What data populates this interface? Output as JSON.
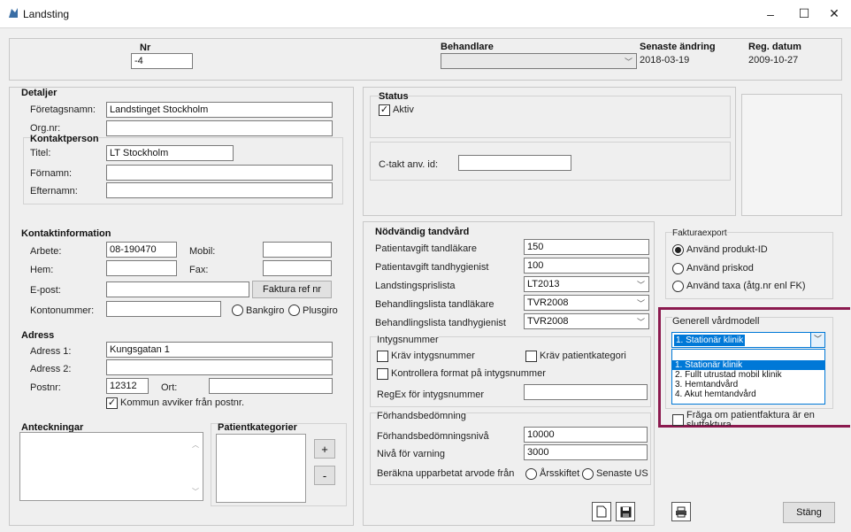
{
  "window": {
    "title": "Landsting",
    "minimize": "–",
    "maximize": "☐",
    "close": "✕"
  },
  "top": {
    "nr_label": "Nr",
    "nr_value": "-4",
    "behandlare_label": "Behandlare",
    "behandlare_value": "",
    "senaste_label": "Senaste ändring",
    "senaste_value": "2018-03-19",
    "reg_label": "Reg. datum",
    "reg_value": "2009-10-27"
  },
  "detaljer": {
    "header": "Detaljer",
    "foretag_label": "Företagsnamn:",
    "foretag_value": "Landstinget Stockholm",
    "orgnr_label": "Org.nr:",
    "orgnr_value": "",
    "kontakt_header": "Kontaktperson",
    "titel_label": "Titel:",
    "titel_value": "LT Stockholm",
    "fornamn_label": "Förnamn:",
    "fornamn_value": "",
    "efternamn_label": "Efternamn:",
    "efternamn_value": ""
  },
  "kontaktinfo": {
    "header": "Kontaktinformation",
    "arbete_label": "Arbete:",
    "arbete_value": "08-190470",
    "mobil_label": "Mobil:",
    "mobil_value": "",
    "hem_label": "Hem:",
    "hem_value": "",
    "fax_label": "Fax:",
    "fax_value": "",
    "epost_label": "E-post:",
    "epost_value": "",
    "faktura_btn": "Faktura ref nr",
    "konto_label": "Kontonummer:",
    "konto_value": "",
    "bankgiro": "Bankgiro",
    "plusgiro": "Plusgiro"
  },
  "adress": {
    "header": "Adress",
    "a1_label": "Adress 1:",
    "a1_value": "Kungsgatan 1",
    "a2_label": "Adress 2:",
    "a2_value": "",
    "postnr_label": "Postnr:",
    "postnr_value": "12312",
    "ort_label": "Ort:",
    "ort_value": "",
    "kommun_label": "Kommun avviker från postnr."
  },
  "anteckningar": {
    "header": "Anteckningar"
  },
  "patientkat": {
    "header": "Patientkategorier",
    "plus": "+",
    "minus": "-"
  },
  "status": {
    "header": "Status",
    "aktiv": "Aktiv",
    "ctakt_label": "C-takt anv. id:",
    "ctakt_value": ""
  },
  "nodvandig": {
    "header": "Nödvändig tandvård",
    "pat_tandlakare_label": "Patientavgift tandläkare",
    "pat_tandlakare_value": "150",
    "pat_hygienist_label": "Patientavgift tandhygienist",
    "pat_hygienist_value": "100",
    "prislista_label": "Landstingsprislista",
    "prislista_value": "LT2013",
    "bl_tandlakare_label": "Behandlingslista tandläkare",
    "bl_tandlakare_value": "TVR2008",
    "bl_hygienist_label": "Behandlingslista tandhygienist",
    "bl_hygienist_value": "TVR2008",
    "intyg_header": "Intygsnummer",
    "krav_intyg": "Kräv intygsnummer",
    "krav_patkat": "Kräv patientkategori",
    "kontrollera": "Kontrollera format på intygsnummer",
    "regex_label": "RegEx för intygsnummer",
    "regex_value": "",
    "forhands_header": "Förhandsbedömning",
    "forhands_niva_label": "Förhandsbedömningsnivå",
    "forhands_niva_value": "10000",
    "varning_label": "Nivå för varning",
    "varning_value": "3000",
    "berakna_label": "Beräkna upparbetat arvode från",
    "arsskiftet": "Årsskiftet",
    "senaste_us": "Senaste US"
  },
  "fakturaexport": {
    "header": "Fakturaexport",
    "opt1": "Använd produkt-ID",
    "opt2": "Använd priskod",
    "opt3": "Använd taxa (åtg.nr enl FK)"
  },
  "vardmodell": {
    "header": "Generell vårdmodell",
    "selected": "1. Stationär klinik",
    "options": [
      "1. Stationär klinik",
      "2. Fullt utrustad mobil klinik",
      "3. Hemtandvård",
      "4. Akut hemtandvård"
    ],
    "fraga": "Fråga om patientfaktura är en slutfaktura"
  },
  "bottom": {
    "new_icon": "🗋",
    "save_icon": "💾",
    "print_icon": "🖶",
    "stang": "Stäng"
  },
  "colors": {
    "highlight": "#8b1a4f",
    "selection": "#0078d7"
  }
}
